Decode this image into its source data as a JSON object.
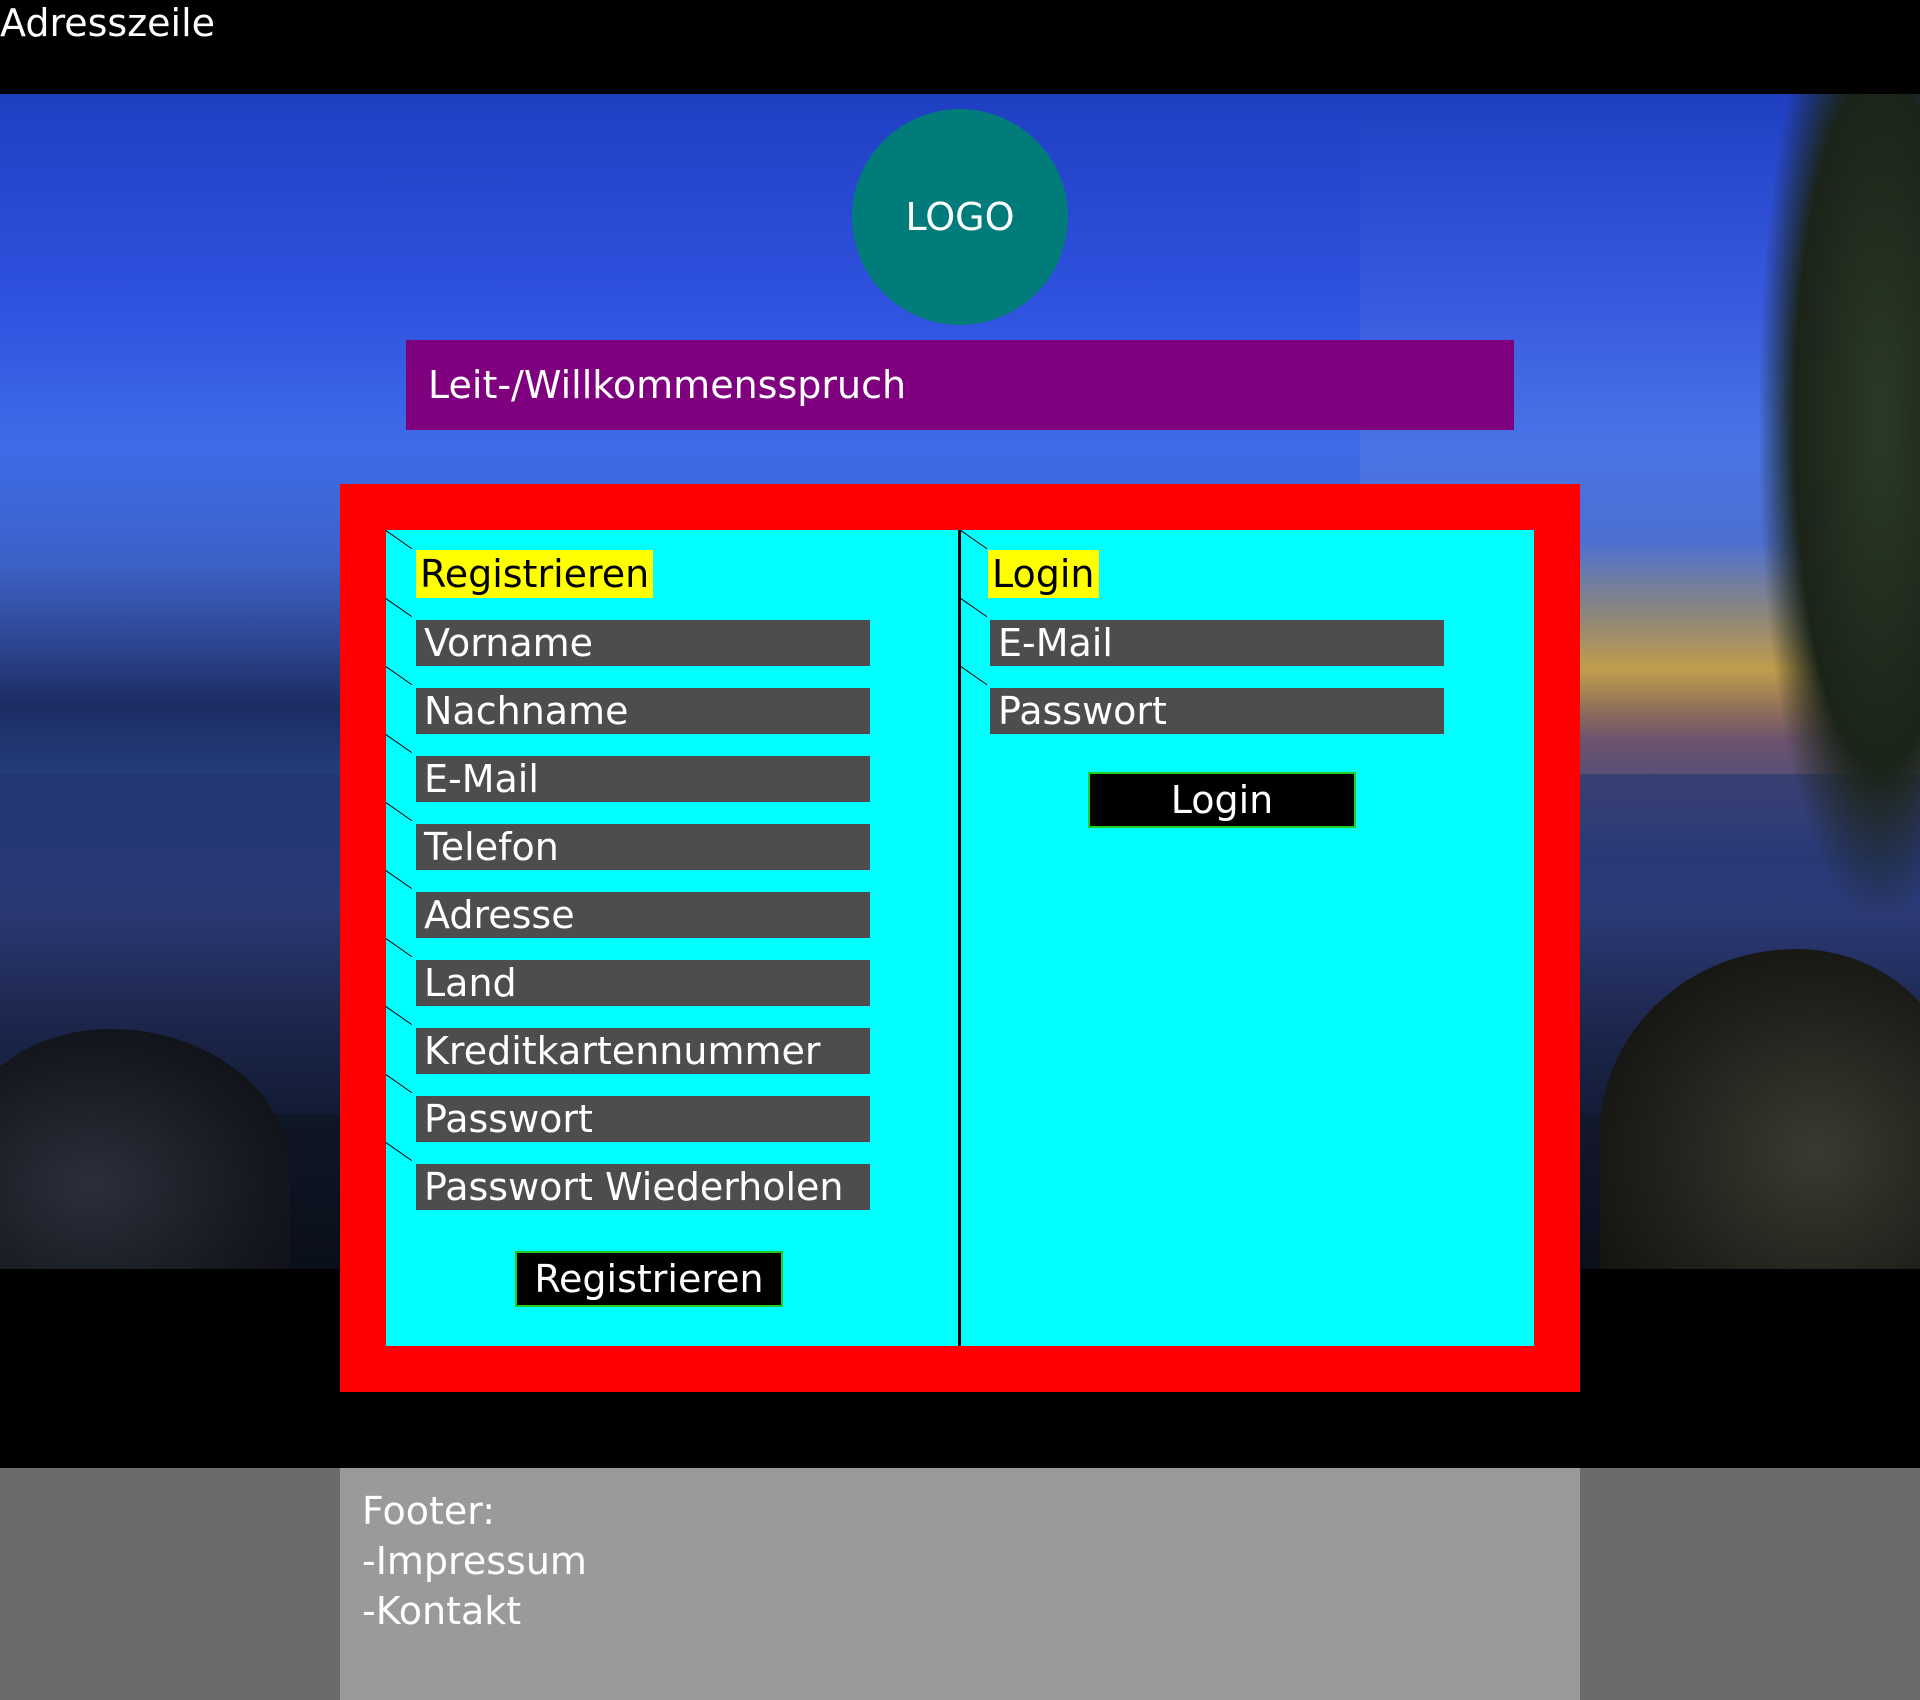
{
  "address_bar": {
    "text": "Adresszeile"
  },
  "logo": {
    "text": "LOGO"
  },
  "slogan": {
    "text": "Leit-/Willkommensspruch"
  },
  "register": {
    "title": "Registrieren",
    "fields": [
      "Vorname",
      "Nachname",
      "E-Mail",
      "Telefon",
      "Adresse",
      "Land",
      "Kreditkartennummer",
      "Passwort",
      "Passwort Wiederholen"
    ],
    "button": "Registrieren"
  },
  "login": {
    "title": "Login",
    "fields": [
      "E-Mail",
      "Passwort"
    ],
    "button": "Login"
  },
  "footer": {
    "heading": "Footer:",
    "items": [
      "-Impressum",
      "-Kontakt"
    ]
  },
  "colors": {
    "frame": "#ff0000",
    "form_background": "#00ffff",
    "field_background": "#4d4d4d",
    "title_highlight": "#ffff00",
    "slogan_background": "#7f007f",
    "logo_background": "#027b7b",
    "button_border": "#22cc22",
    "footer_background": "#9a9a9a"
  }
}
